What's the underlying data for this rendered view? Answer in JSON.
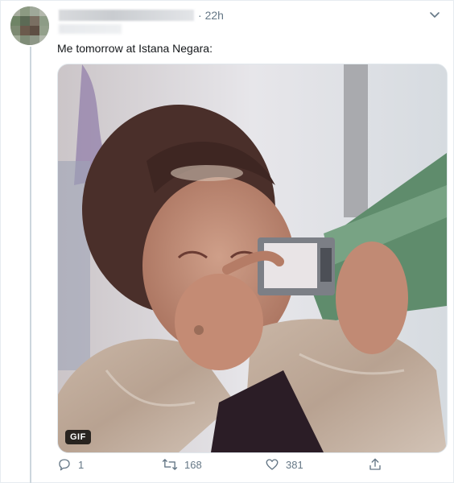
{
  "tweet": {
    "time": "22h",
    "text": "Me tomorrow at Istana Negara:",
    "media_badge": "GIF"
  },
  "actions": {
    "reply_count": "1",
    "retweet_count": "168",
    "like_count": "381"
  },
  "colors": {
    "muted": "#657786",
    "border": "#e6ecf0",
    "text": "#14171a"
  }
}
